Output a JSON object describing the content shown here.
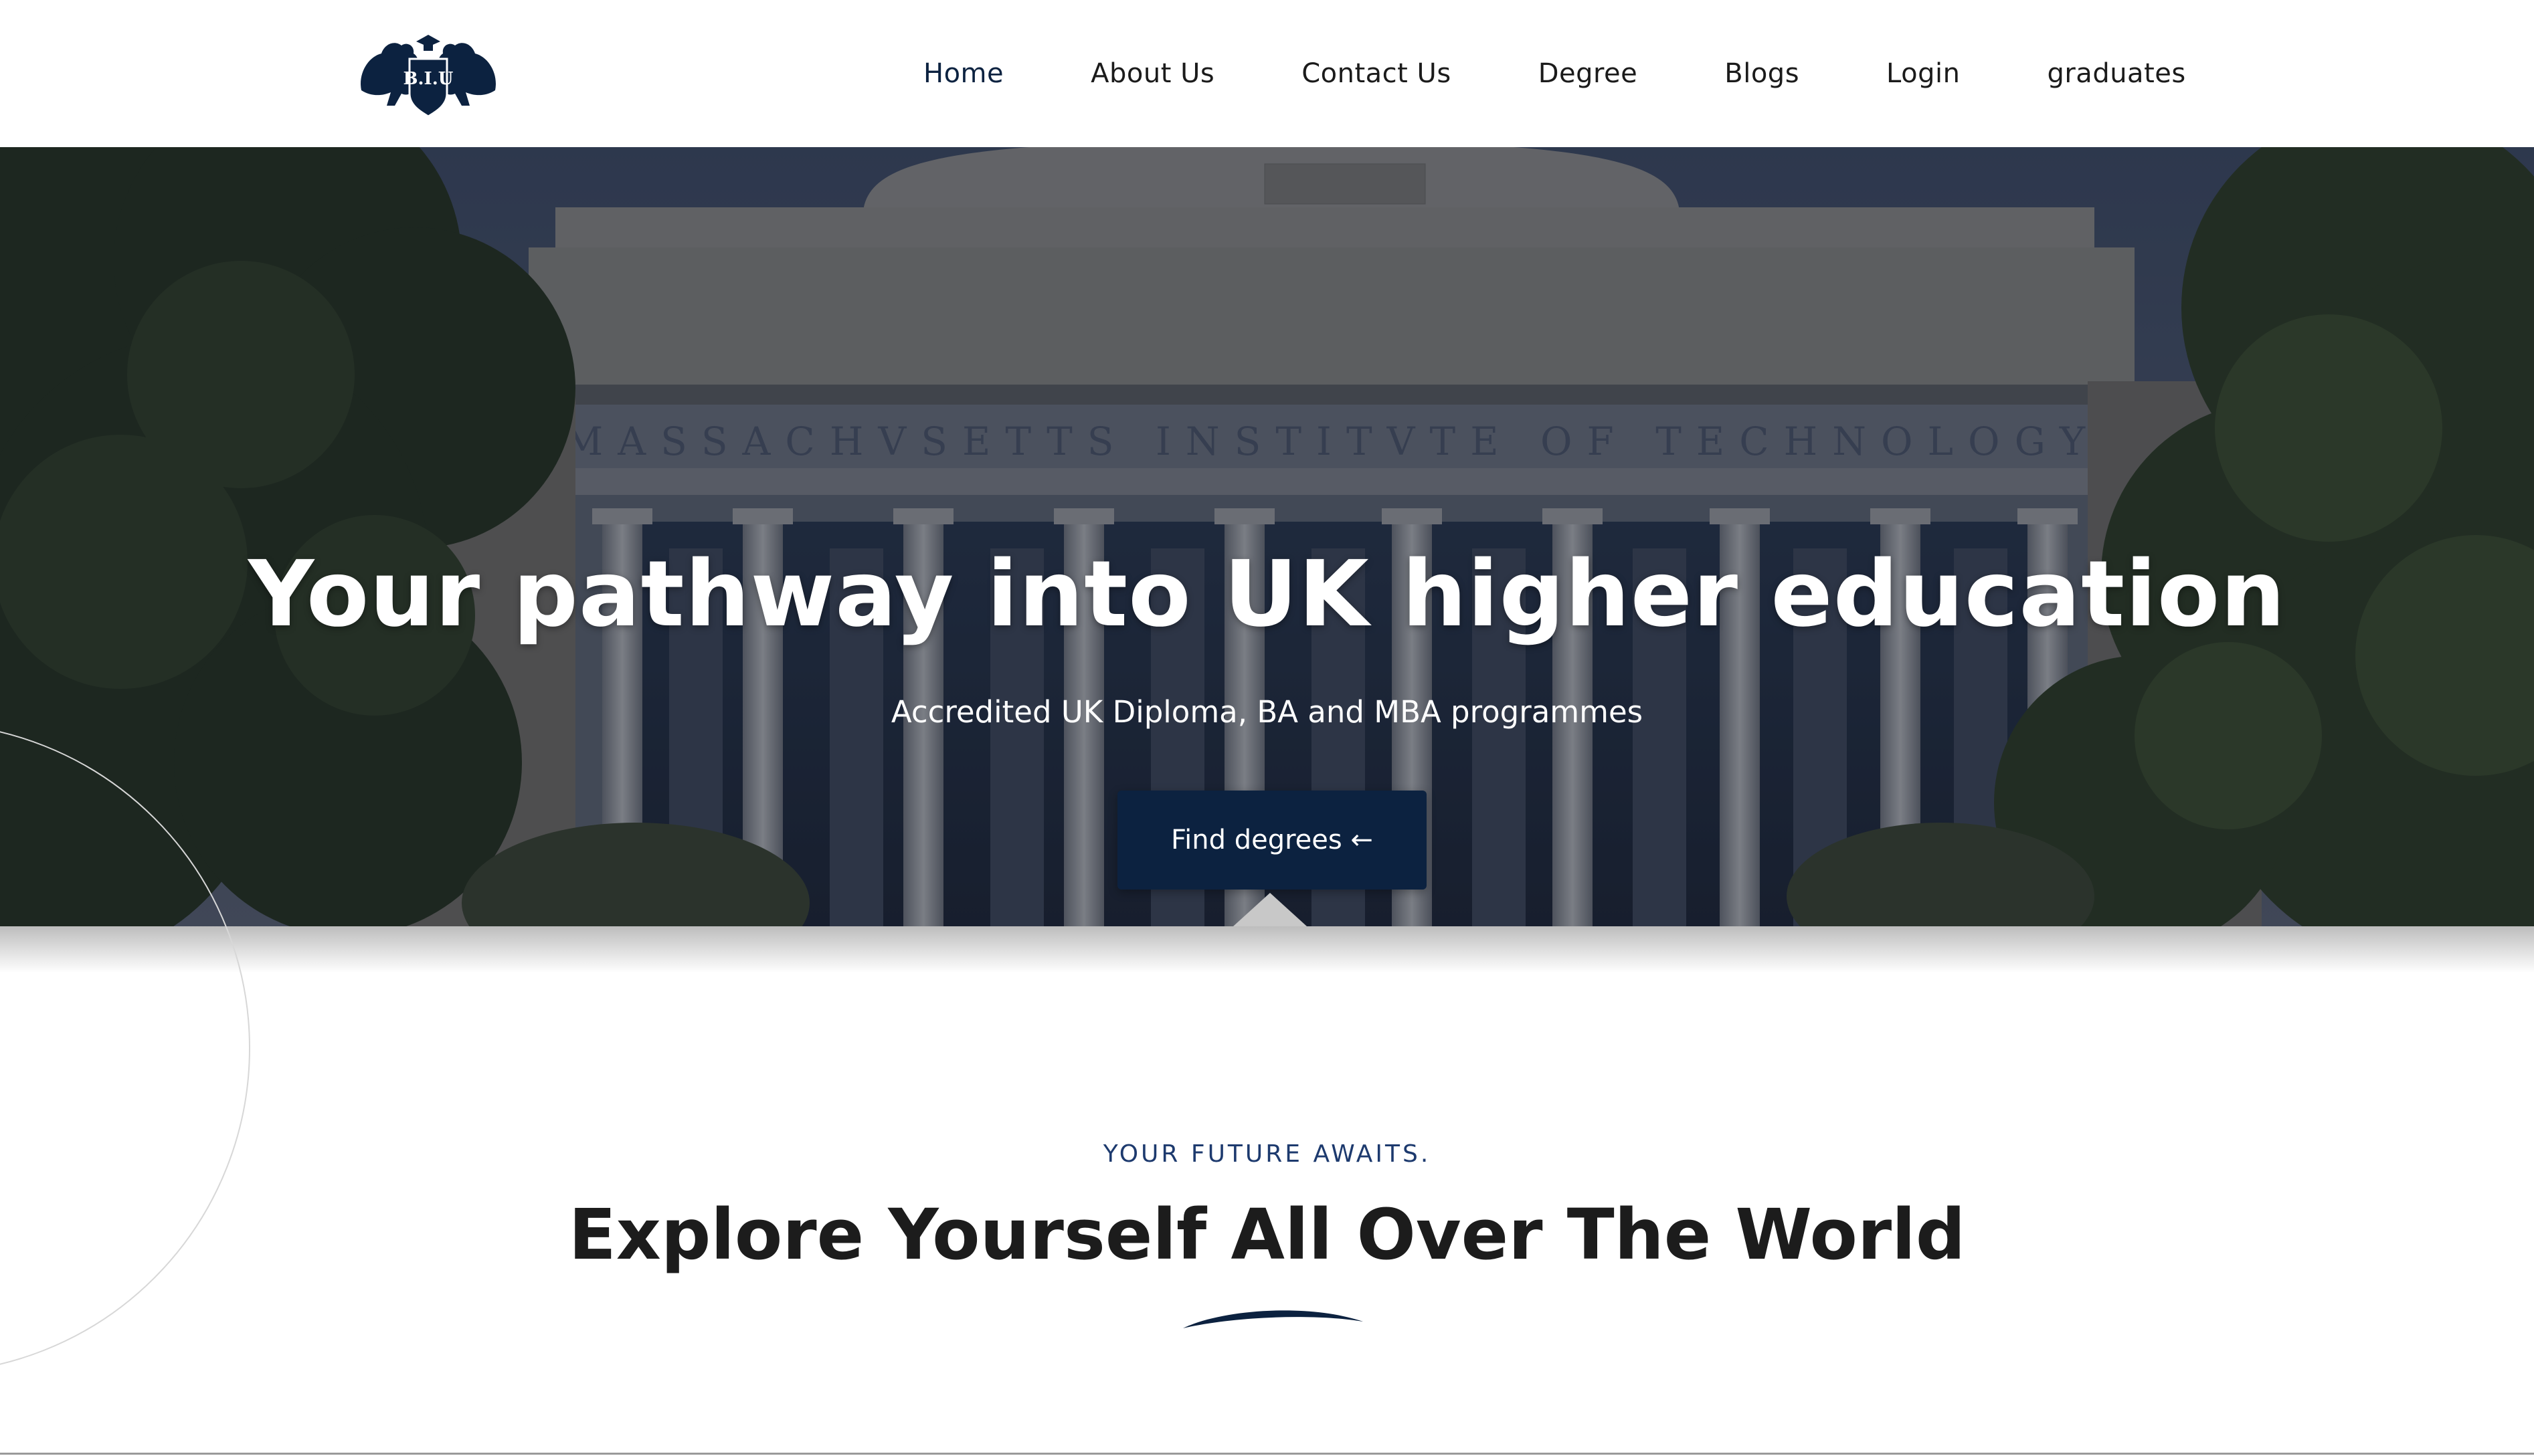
{
  "header": {
    "logo_text": "B.I.U",
    "nav": [
      {
        "label": "Home",
        "active": true
      },
      {
        "label": "About Us",
        "active": false
      },
      {
        "label": "Contact Us",
        "active": false
      },
      {
        "label": "Degree",
        "active": false
      },
      {
        "label": "Blogs",
        "active": false
      },
      {
        "label": "Login",
        "active": false
      },
      {
        "label": "graduates",
        "active": false
      }
    ]
  },
  "hero": {
    "title": "Your pathway into UK higher education",
    "subtitle": "Accredited UK Diploma, BA and MBA programmes",
    "button_label": "Find degrees ←",
    "background_image": "university-building-photo"
  },
  "section": {
    "kicker": "YOUR FUTURE AWAITS.",
    "title": "Explore Yourself All Over The World"
  },
  "colors": {
    "brand_navy": "#0c2240",
    "kicker_blue": "#1d3a6e",
    "text_dark": "#1c1c1c",
    "white": "#ffffff"
  }
}
